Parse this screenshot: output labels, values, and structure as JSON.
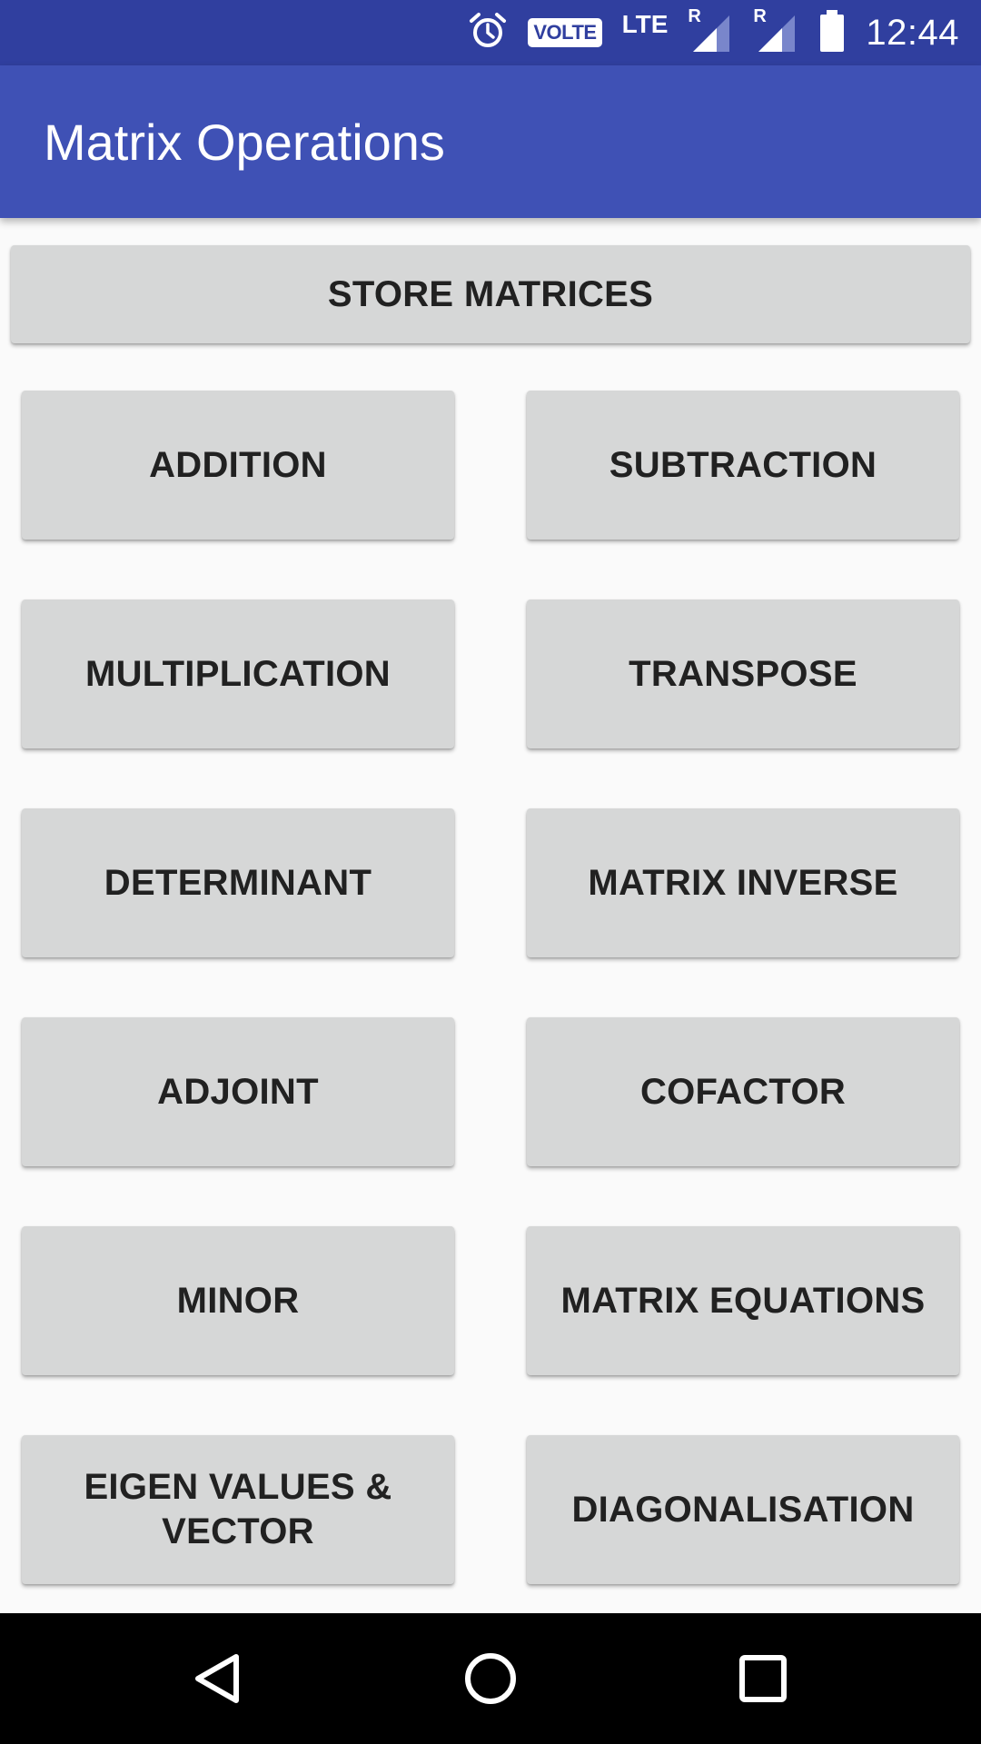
{
  "status_bar": {
    "time": "12:44",
    "volte": "VOLTE",
    "lte": "LTE",
    "roaming_1": "R",
    "roaming_2": "R",
    "icons": [
      "alarm-icon",
      "volte-icon",
      "signal-icon",
      "signal-icon",
      "battery-icon"
    ]
  },
  "app_bar": {
    "title": "Matrix Operations",
    "color": "#3f51b5",
    "status_color": "#303f9f"
  },
  "store_button": {
    "label": "STORE MATRICES"
  },
  "operations": [
    {
      "label": "ADDITION"
    },
    {
      "label": "SUBTRACTION"
    },
    {
      "label": "MULTIPLICATION"
    },
    {
      "label": "TRANSPOSE"
    },
    {
      "label": "DETERMINANT"
    },
    {
      "label": "MATRIX INVERSE"
    },
    {
      "label": "ADJOINT"
    },
    {
      "label": "COFACTOR"
    },
    {
      "label": "MINOR"
    },
    {
      "label": "MATRIX EQUATIONS"
    },
    {
      "label": "EIGEN VALUES & VECTOR"
    },
    {
      "label": "DIAGONALISATION"
    }
  ],
  "nav_bar": {
    "icons": [
      "back-icon",
      "home-icon",
      "recents-icon"
    ]
  }
}
